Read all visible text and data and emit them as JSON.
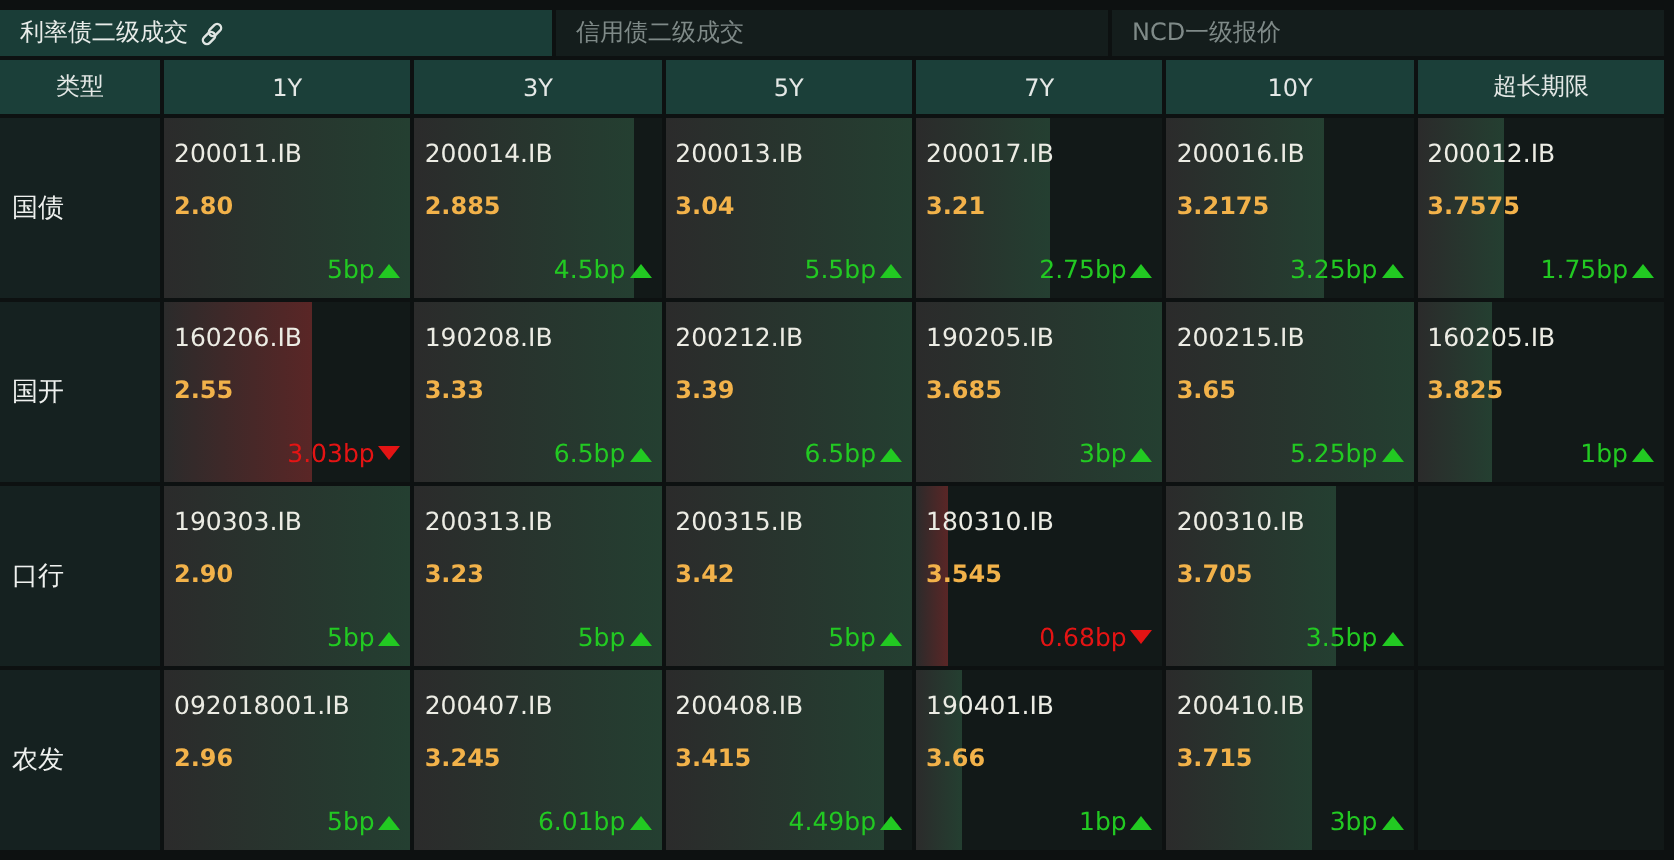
{
  "tabs": [
    {
      "label": "利率债二级成交",
      "selected": true
    },
    {
      "label": "信用债二级成交",
      "selected": false
    },
    {
      "label": "NCD一级报价",
      "selected": false
    }
  ],
  "table": {
    "corner": "类型",
    "columns": [
      "1Y",
      "3Y",
      "5Y",
      "7Y",
      "10Y",
      "超长期限"
    ],
    "rows": [
      {
        "type": "国债",
        "cells": [
          {
            "code": "200011.IB",
            "yield": "2.80",
            "change": "5bp",
            "falling": false,
            "level": 1
          },
          {
            "code": "200014.IB",
            "yield": "2.885",
            "change": "4.5bp",
            "falling": false,
            "level": 0.89
          },
          {
            "code": "200013.IB",
            "yield": "3.04",
            "change": "5.5bp",
            "falling": false,
            "level": 1
          },
          {
            "code": "200017.IB",
            "yield": "3.21",
            "change": "2.75bp",
            "falling": false,
            "level": 0.54
          },
          {
            "code": "200016.IB",
            "yield": "3.2175",
            "change": "3.25bp",
            "falling": false,
            "level": 0.64
          },
          {
            "code": "200012.IB",
            "yield": "3.7575",
            "change": "1.75bp",
            "falling": false,
            "level": 0.35
          }
        ]
      },
      {
        "type": "国开",
        "cells": [
          {
            "code": "160206.IB",
            "yield": "2.55",
            "change": "3.03bp",
            "falling": true,
            "level": 0.6
          },
          {
            "code": "190208.IB",
            "yield": "3.33",
            "change": "6.5bp",
            "falling": false,
            "level": 1
          },
          {
            "code": "200212.IB",
            "yield": "3.39",
            "change": "6.5bp",
            "falling": false,
            "level": 1
          },
          {
            "code": "190205.IB",
            "yield": "3.685",
            "change": "3bp",
            "falling": false,
            "level": 1
          },
          {
            "code": "200215.IB",
            "yield": "3.65",
            "change": "5.25bp",
            "falling": false,
            "level": 1
          },
          {
            "code": "160205.IB",
            "yield": "3.825",
            "change": "1bp",
            "falling": false,
            "level": 0.3
          }
        ]
      },
      {
        "type": "口行",
        "cells": [
          {
            "code": "190303.IB",
            "yield": "2.90",
            "change": "5bp",
            "falling": false,
            "level": 1
          },
          {
            "code": "200313.IB",
            "yield": "3.23",
            "change": "5bp",
            "falling": false,
            "level": 1
          },
          {
            "code": "200315.IB",
            "yield": "3.42",
            "change": "5bp",
            "falling": false,
            "level": 1
          },
          {
            "code": "180310.IB",
            "yield": "3.545",
            "change": "0.68bp",
            "falling": true,
            "level": 0.13
          },
          {
            "code": "200310.IB",
            "yield": "3.705",
            "change": "3.5bp",
            "falling": false,
            "level": 0.69
          }
        ]
      },
      {
        "type": "农发",
        "cells": [
          {
            "code": "092018001.IB",
            "yield": "2.96",
            "change": "5bp",
            "falling": false,
            "level": 1
          },
          {
            "code": "200407.IB",
            "yield": "3.245",
            "change": "6.01bp",
            "falling": false,
            "level": 1
          },
          {
            "code": "200408.IB",
            "yield": "3.415",
            "change": "4.49bp",
            "falling": false,
            "level": 0.89
          },
          {
            "code": "190401.IB",
            "yield": "3.66",
            "change": "1bp",
            "falling": false,
            "level": 0.19
          },
          {
            "code": "200410.IB",
            "yield": "3.715",
            "change": "3bp",
            "falling": false,
            "level": 0.59
          }
        ]
      }
    ]
  }
}
